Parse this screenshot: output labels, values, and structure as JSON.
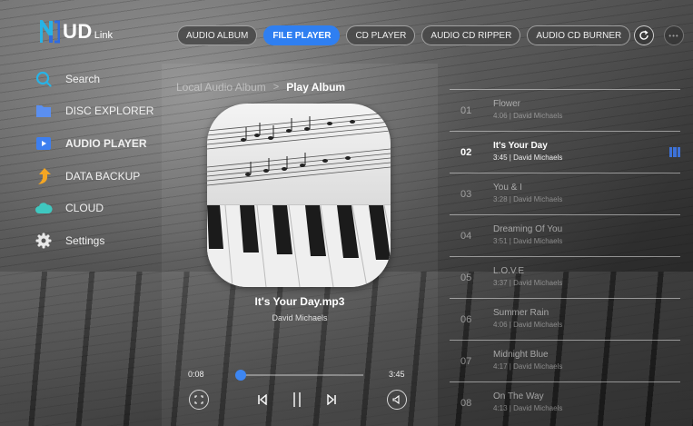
{
  "app": {
    "logo_text": "UD",
    "logo_sub": "Link"
  },
  "tabs": [
    {
      "label": "AUDIO ALBUM",
      "active": false
    },
    {
      "label": "FILE PLAYER",
      "active": true
    },
    {
      "label": "CD PLAYER",
      "active": false
    },
    {
      "label": "AUDIO CD RIPPER",
      "active": false
    },
    {
      "label": "AUDIO CD BURNER",
      "active": false
    }
  ],
  "sidebar": {
    "items": [
      {
        "label": "Search",
        "icon": "search-icon"
      },
      {
        "label": "DISC EXPLORER",
        "icon": "folder-icon"
      },
      {
        "label": "AUDIO PLAYER",
        "icon": "play-icon",
        "active": true
      },
      {
        "label": "DATA BACKUP",
        "icon": "upload-arrow-icon"
      },
      {
        "label": "CLOUD",
        "icon": "cloud-icon"
      },
      {
        "label": "Settings",
        "icon": "gear-icon"
      }
    ]
  },
  "breadcrumb": {
    "parent": "Local Audio Album",
    "separator": ">",
    "current": "Play Album"
  },
  "now_playing": {
    "title": "It's Your Day.mp3",
    "artist": "David Michaels",
    "elapsed": "0:08",
    "duration": "3:45",
    "progress": 0.035
  },
  "playlist": {
    "tracks": [
      {
        "number": "01",
        "title": "Flower",
        "meta": "4:06 | David Michaels"
      },
      {
        "number": "02",
        "title": "It's Your Day",
        "meta": "3:45 | David Michaels",
        "active": true
      },
      {
        "number": "03",
        "title": "You & I",
        "meta": "3:28 | David Michaels"
      },
      {
        "number": "04",
        "title": "Dreaming Of You",
        "meta": "3:51 | David Michaels"
      },
      {
        "number": "05",
        "title": "L.O.V.E",
        "meta": "3:37 | David Michaels"
      },
      {
        "number": "06",
        "title": "Summer Rain",
        "meta": "4:06 | David Michaels"
      },
      {
        "number": "07",
        "title": "Midnight Blue",
        "meta": "4:17 | David Michaels"
      },
      {
        "number": "08",
        "title": "On The Way",
        "meta": "4:13 | David Michaels"
      }
    ]
  },
  "colors": {
    "accent": "#2f7ff1",
    "logo_cyan": "#27b3e6",
    "logo_blue": "#2f6be0"
  }
}
